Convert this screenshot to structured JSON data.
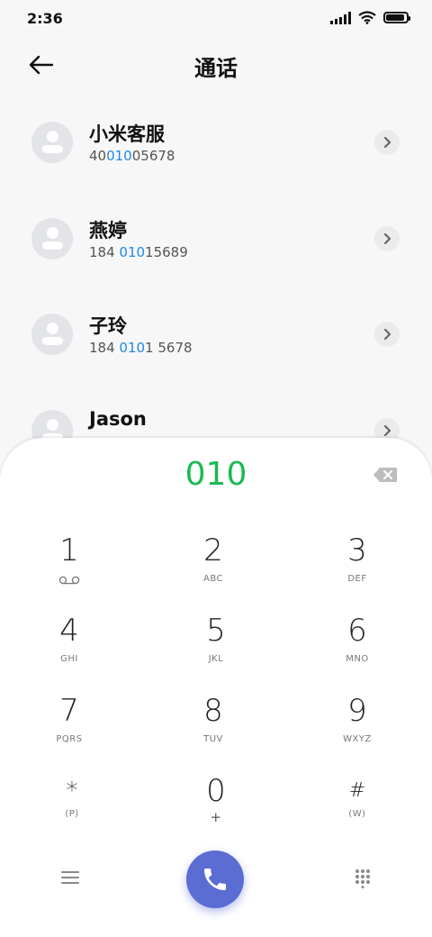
{
  "status": {
    "time": "2:36"
  },
  "header": {
    "title": "通话"
  },
  "contacts": [
    {
      "name": "小米客服",
      "number_pre": "40",
      "number_hl": "010",
      "number_post": "05678"
    },
    {
      "name": "燕婷",
      "number_pre": "184 ",
      "number_hl": "010",
      "number_post": "15689"
    },
    {
      "name": "子玲",
      "number_pre": "184 ",
      "number_hl": "010",
      "number_post": "1 5678"
    },
    {
      "name": "Jason",
      "number_pre": "",
      "number_hl": "",
      "number_post": ""
    }
  ],
  "dialer": {
    "dialed": "010",
    "keys": [
      {
        "digit": "1",
        "letters": ""
      },
      {
        "digit": "2",
        "letters": "ABC"
      },
      {
        "digit": "3",
        "letters": "DEF"
      },
      {
        "digit": "4",
        "letters": "GHI"
      },
      {
        "digit": "5",
        "letters": "JKL"
      },
      {
        "digit": "6",
        "letters": "MNO"
      },
      {
        "digit": "7",
        "letters": "PQRS"
      },
      {
        "digit": "8",
        "letters": "TUV"
      },
      {
        "digit": "9",
        "letters": "WXYZ"
      },
      {
        "digit": "*",
        "letters": "(P)"
      },
      {
        "digit": "0",
        "letters": "+"
      },
      {
        "digit": "#",
        "letters": "(W)"
      }
    ]
  },
  "colors": {
    "dialed": "#1db954",
    "highlight": "#1e88e5",
    "call": "#5b6cd3"
  },
  "icons": {
    "back": "arrow-left-icon",
    "chevron": "chevron-right-icon",
    "delete": "backspace-icon",
    "voicemail": "voicemail-icon",
    "menu": "menu-icon",
    "call": "phone-icon",
    "keypad": "keypad-icon"
  }
}
